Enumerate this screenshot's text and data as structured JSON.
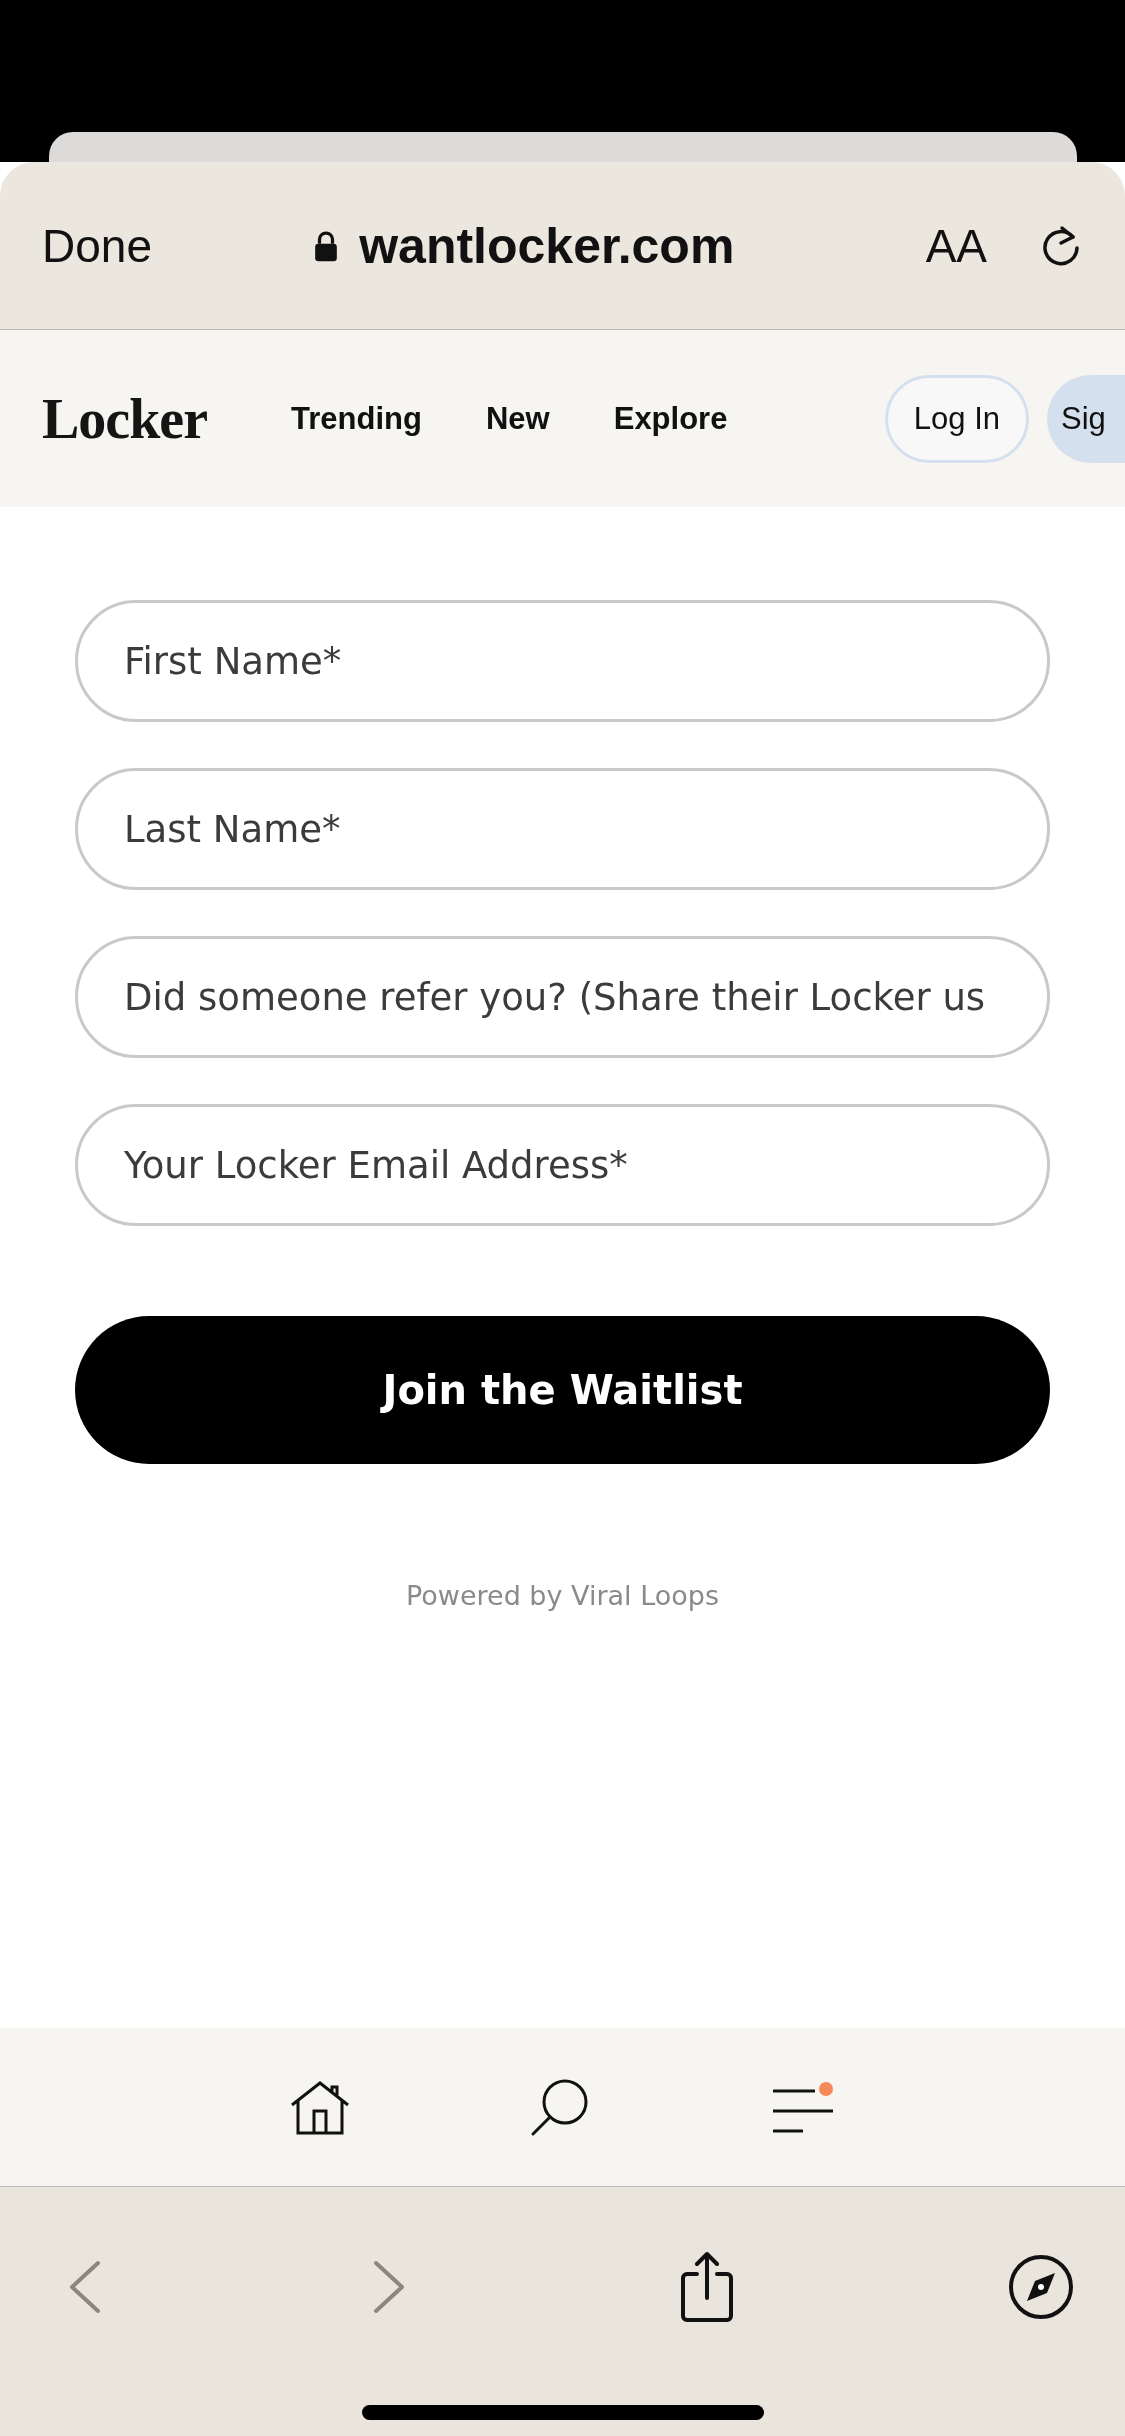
{
  "browser": {
    "done": "Done",
    "url": "wantlocker.com",
    "text_size": "AA"
  },
  "nav": {
    "logo": "Locker",
    "links": [
      "Trending",
      "New",
      "Explore"
    ],
    "login": "Log In",
    "signup": "Sig"
  },
  "form": {
    "fields": [
      {
        "placeholder": "First Name*"
      },
      {
        "placeholder": "Last Name*"
      },
      {
        "placeholder": "Did someone refer you? (Share their Locker us"
      },
      {
        "placeholder": "Your Locker Email Address*"
      }
    ],
    "submit": "Join the Waitlist",
    "powered_by": "Powered by Viral Loops"
  },
  "tab_bar": [
    {
      "kind": "home"
    },
    {
      "kind": "search"
    },
    {
      "kind": "menu"
    }
  ],
  "toolbar": [
    {
      "kind": "back",
      "disabled": true
    },
    {
      "kind": "forward",
      "disabled": true
    },
    {
      "kind": "share",
      "disabled": false
    },
    {
      "kind": "compass",
      "disabled": false
    }
  ]
}
